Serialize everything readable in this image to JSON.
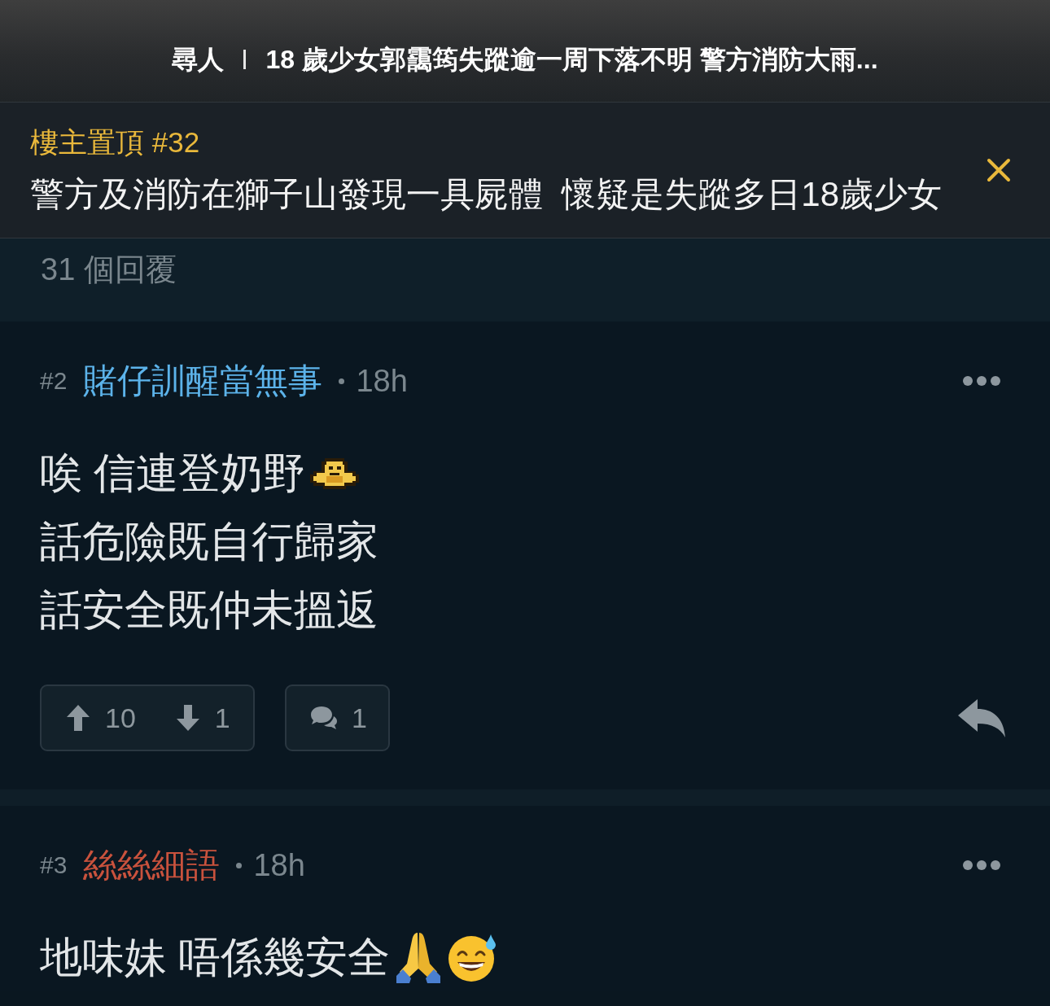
{
  "header": {
    "category": "尋人",
    "title": "18 歲少女郭靄筠失蹤逾一周下落不明 警方消防大雨..."
  },
  "pinned": {
    "label": "樓主置頂 #32",
    "text": "警方及消防在獅子山發現一具屍體  懷疑是失蹤多日18歲少女"
  },
  "reply_count": "31 個回覆",
  "posts": [
    {
      "number": "#2",
      "author": "賭仔訓醒當無事",
      "color": "#5cb3ea",
      "time": "18h",
      "lines": [
        "唉 信連登奶野",
        "話危險既自行歸家",
        "話安全既仲未搵返"
      ],
      "upvotes": "10",
      "downvotes": "1",
      "comments": "1"
    },
    {
      "number": "#3",
      "author": "絲絲細語",
      "color": "#c9523d",
      "time": "18h",
      "lines": [
        "地味妹 唔係幾安全"
      ]
    }
  ]
}
